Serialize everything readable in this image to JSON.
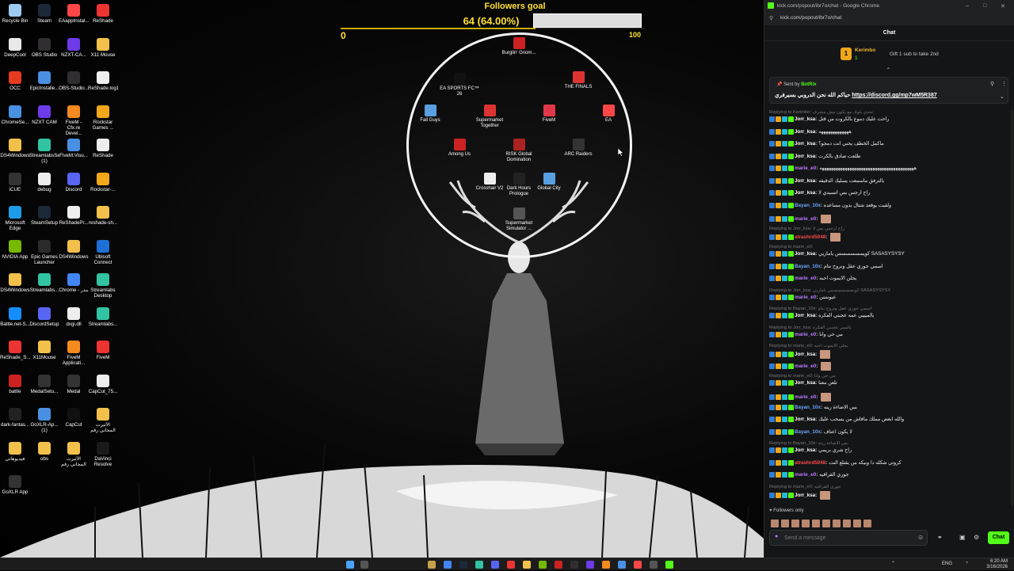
{
  "desktop": {
    "icons": [
      {
        "label": "Recycle Bin",
        "color": "#9ec9f0"
      },
      {
        "label": "DeepCool",
        "color": "#e8e8e8"
      },
      {
        "label": "OCC",
        "color": "#e63b1f"
      },
      {
        "label": "ChromeSe...",
        "color": "#4a90e2"
      },
      {
        "label": "DS4Windows",
        "color": "#f3c14b"
      },
      {
        "label": "iCUE",
        "color": "#333"
      },
      {
        "label": "Microsoft Edge",
        "color": "#1e9be8"
      },
      {
        "label": "NVIDIA App",
        "color": "#76b900"
      },
      {
        "label": "DS4Windows",
        "color": "#f3c14b"
      },
      {
        "label": "Battle.net-S...",
        "color": "#148eff"
      },
      {
        "label": "ReShade_S...",
        "color": "#e33"
      },
      {
        "label": "battle",
        "color": "#c22"
      },
      {
        "label": "dark-fantas...",
        "color": "#222"
      },
      {
        "label": "فيديوهاتي",
        "color": "#f3c14b"
      },
      {
        "label": "GoXLR App",
        "color": "#333"
      },
      {
        "label": "Steam",
        "color": "#1b2838"
      },
      {
        "label": "OBS Studio",
        "color": "#302e31"
      },
      {
        "label": "EpicInstalle...",
        "color": "#4a90e2"
      },
      {
        "label": "NZXT CAM",
        "color": "#6d3be8"
      },
      {
        "label": "StreamlabsSetup (1)",
        "color": "#31c3a2"
      },
      {
        "label": "debug",
        "color": "#eee"
      },
      {
        "label": "SteamSetup",
        "color": "#1b2838"
      },
      {
        "label": "Epic Games Launcher",
        "color": "#2a2a2a"
      },
      {
        "label": "Streamlabs...",
        "color": "#31c3a2"
      },
      {
        "label": "DiscordSetup",
        "color": "#5865f2"
      },
      {
        "label": "X11Mouse",
        "color": "#f3c14b"
      },
      {
        "label": "MedalSetu...",
        "color": "#333"
      },
      {
        "label": "GoXLR-Ap... (1)",
        "color": "#4a90e2"
      },
      {
        "label": "obs",
        "color": "#f3c14b"
      },
      {
        "label": "EAappInstal...",
        "color": "#ff4747"
      },
      {
        "label": "NZXT-CA...",
        "color": "#6d3be8"
      },
      {
        "label": "OBS-Studio...",
        "color": "#302e31"
      },
      {
        "label": "FiveM - Cfx.re Devel...",
        "color": "#f58a1f"
      },
      {
        "label": "FiveM.Visu...",
        "color": "#4a90e2"
      },
      {
        "label": "Discord",
        "color": "#5865f2"
      },
      {
        "label": "ReShadePr...",
        "color": "#eee"
      },
      {
        "label": "DS4Windows",
        "color": "#f3c14b"
      },
      {
        "label": "Chrome - بندر",
        "color": "#4285f4"
      },
      {
        "label": "dxgi.dll",
        "color": "#eee"
      },
      {
        "label": "FiveM Applicati...",
        "color": "#f58a1f"
      },
      {
        "label": "Medal",
        "color": "#333"
      },
      {
        "label": "CapCut",
        "color": "#111"
      },
      {
        "label": "الأثيرت المجاني رقم",
        "color": "#f3c14b"
      },
      {
        "label": "ReShade",
        "color": "#e33"
      },
      {
        "label": "X11 Mouse",
        "color": "#f3c14b"
      },
      {
        "label": "ReShade.log1",
        "color": "#eee"
      },
      {
        "label": "Rockstar Games ...",
        "color": "#f3a81c"
      },
      {
        "label": "ReShade",
        "color": "#eee"
      },
      {
        "label": "Rockstar-...",
        "color": "#f3a81c"
      },
      {
        "label": "reshade-sh...",
        "color": "#f3c14b"
      },
      {
        "label": "Ubisoft Connect",
        "color": "#1e6fd8"
      },
      {
        "label": "Streamlabs Desktop",
        "color": "#31c3a2"
      },
      {
        "label": "Streamlabs...",
        "color": "#31c3a2"
      },
      {
        "label": "FiveM",
        "color": "#e33"
      },
      {
        "label": "CapCut_75...",
        "color": "#eee"
      },
      {
        "label": "الأثيرت المجاني رقم",
        "color": "#f3c14b"
      },
      {
        "label": "DaVinci Resolve",
        "color": "#1a1a1a"
      }
    ],
    "center_icons": [
      {
        "label": "Burglin' Gnom...",
        "color": "#c22"
      },
      {
        "label": "EA SPORTS FC™ 26",
        "color": "#111"
      },
      {
        "label": "THE FINALS",
        "color": "#d33"
      },
      {
        "label": "Fall Guys",
        "color": "#5aa0e0"
      },
      {
        "label": "Supermarket Together",
        "color": "#d33"
      },
      {
        "label": "FiveM",
        "color": "#e0384a"
      },
      {
        "label": "EA",
        "color": "#ff4747"
      },
      {
        "label": "Among Us",
        "color": "#c22"
      },
      {
        "label": "RISK Global Domination",
        "color": "#a22"
      },
      {
        "label": "ARC Raiders",
        "color": "#333"
      },
      {
        "label": "Crosshair V2",
        "color": "#eee"
      },
      {
        "label": "Dark Hours Prologue",
        "color": "#222"
      },
      {
        "label": "Global City",
        "color": "#5aa0e0"
      },
      {
        "label": "Supermarket Simulator ...",
        "color": "#555"
      }
    ]
  },
  "goal": {
    "title": "Followers goal",
    "value": "64 (64.00%)",
    "progress_percent": 64,
    "min": "0",
    "max": "100"
  },
  "browser": {
    "title": "kick.com/popout/ibr7o/chat - Google Chrome",
    "address": "kick.com/popout/ibr7o/chat"
  },
  "chat": {
    "header": "Chat",
    "gifter": {
      "badge": "1",
      "name": "Kerimbo",
      "count": "1",
      "text": "Gift 1 sub to take 2nd"
    },
    "pinned": {
      "sent_by_label": "Sent by",
      "sender": "BotRix",
      "message": "حياكم الله نحن الدروبي بسيرفري",
      "link": "https://discord.gg/mp7wM5R387"
    },
    "messages": [
      {
        "reply": "Replying to Kerimbo: تحدي بلوك مع يكون مش مشرف",
        "user": "Jorr_ksa",
        "color": "#fff",
        "text": "راحت عليك دموع بالكروت من قتل"
      },
      {
        "reply": "",
        "user": "Jorr_ksa",
        "color": "#fff",
        "text": "هههههههههههههه"
      },
      {
        "reply": "",
        "user": "Jorr_ksa",
        "color": "#fff",
        "text": "ماكمل الخطف يحني انت دمجو؟"
      },
      {
        "reply": "",
        "user": "Jorr_ksa",
        "color": "#fff",
        "text": "طلعت صادق بالكرت"
      },
      {
        "reply": "",
        "user": "marie_e0",
        "color": "#b77cff",
        "text": "هههههههههههههههههههههههههههههههههههههههههه"
      },
      {
        "reply": "",
        "user": "Jorr_ksa",
        "color": "#fff",
        "text": "بالترفق ماسمعت يسليك الدقيقه"
      },
      {
        "reply": "",
        "user": "Jorr_ksa",
        "color": "#fff",
        "text": "راح أرجس بس أتسيدي لا"
      },
      {
        "reply": "",
        "user": "Bayan_10x",
        "color": "#6aa7ff",
        "text": "ولقيت يوقعد شتال بدون مساعده"
      },
      {
        "reply": "",
        "user": "marie_e0",
        "color": "#b77cff",
        "text": ""
      },
      {
        "reply": "Replying to Jorr_ksa: راح أرجس بس لا",
        "user": "atrashrd5048",
        "color": "#ff4a4a",
        "text": ""
      },
      {
        "reply": "Replying to marie_e0:",
        "user": "Jorr_ksa",
        "color": "#fff",
        "text": "كويسسسسسس ياماريي SASASYSYSY"
      },
      {
        "reply": "",
        "user": "Bayan_10x",
        "color": "#6aa7ff",
        "text": "اسمي جوري عقل ونروح ننام"
      },
      {
        "reply": "",
        "user": "marie_e0",
        "color": "#b77cff",
        "text": "يجلن الايموت احبه"
      },
      {
        "reply": "Replying to Jorr_ksa: كويسسسسسس ياماريي SASASYSYSY",
        "user": "marie_e0",
        "color": "#b77cff",
        "text": "عيوننننن"
      },
      {
        "reply": "Replying to Bayan_10x: اسمي جوري عقل ونروح ننام",
        "user": "Jorr_ksa",
        "color": "#fff",
        "text": "يالميييي عمه عجبني الفكره"
      },
      {
        "reply": "Replying to Jorr_ksa: يالميي عجبني الفكره",
        "user": "marie_e0",
        "color": "#b77cff",
        "text": "مي حي وانا"
      },
      {
        "reply": "Replying to marie_e0: يجلن الايموت احبه",
        "user": "Jorr_ksa",
        "color": "#fff",
        "text": ""
      },
      {
        "reply": "",
        "user": "marie_e0",
        "color": "#b77cff",
        "text": ""
      },
      {
        "reply": "Replying to marie_e0: مي حي وانا",
        "user": "Jorr_ksa",
        "color": "#fff",
        "text": "تلعن معنا"
      },
      {
        "reply": "",
        "user": "marie_e0",
        "color": "#b77cff",
        "text": ""
      },
      {
        "reply": "",
        "user": "Bayan_10x",
        "color": "#6aa7ff",
        "text": "بس الاضاءة ريته"
      },
      {
        "reply": "",
        "user": "Jorr_ksa",
        "color": "#fff",
        "text": "والله ابغض مملك ماقاش من يسحب عليك"
      },
      {
        "reply": "",
        "user": "Bayan_10x",
        "color": "#6aa7ff",
        "text": "لا يكون اعتاف"
      },
      {
        "reply": "Replying to Bayan_10x: بس الاضاءة ريته",
        "user": "Jorr_ksa",
        "color": "#fff",
        "text": "راح شري بريمي"
      },
      {
        "reply": "",
        "user": "atrashrd5048",
        "color": "#ff4a4a",
        "text": "كروتي شكله دا وبيكه من يقتلع النت"
      },
      {
        "reply": "",
        "user": "marie_e0",
        "color": "#b77cff",
        "text": "جوري القراقيه"
      },
      {
        "reply": "Replying to marie_e0: جوري القراقيه",
        "user": "Jorr_ksa",
        "color": "#fff",
        "text": ""
      }
    ],
    "followers_only": "Followers only",
    "input_placeholder": "Send a message",
    "send_label": "Chat"
  },
  "taskbar": {
    "lang": "ENG",
    "time": "6:20 AM",
    "date": "3/16/2026"
  }
}
